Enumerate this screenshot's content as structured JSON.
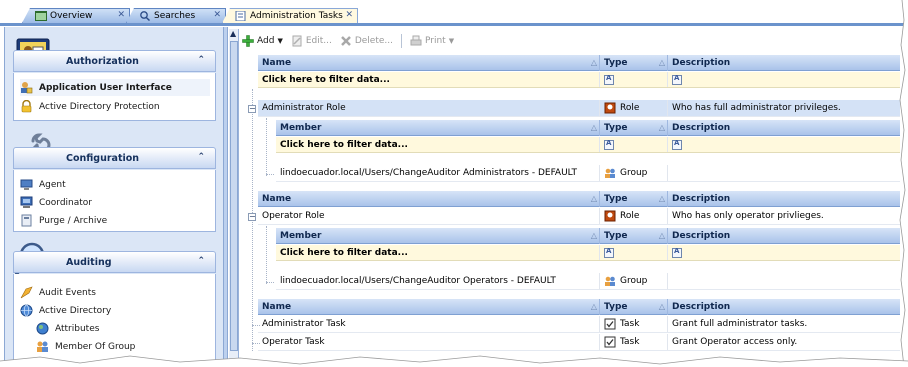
{
  "tabs": [
    {
      "label": "Overview",
      "active": false
    },
    {
      "label": "Searches",
      "active": false
    },
    {
      "label": "Administration Tasks",
      "active": true
    }
  ],
  "nav": {
    "groups": [
      {
        "title": "Authorization",
        "icon": "authorization-icon",
        "items": [
          {
            "label": "Application User Interface",
            "icon": "user-lock-icon",
            "selected": true
          },
          {
            "label": "Active Directory Protection",
            "icon": "padlock-icon",
            "selected": false
          }
        ]
      },
      {
        "title": "Configuration",
        "icon": "wrench-icon",
        "items": [
          {
            "label": "Agent",
            "icon": "agent-icon"
          },
          {
            "label": "Coordinator",
            "icon": "coordinator-icon"
          },
          {
            "label": "Purge / Archive",
            "icon": "purge-icon"
          }
        ]
      },
      {
        "title": "Auditing",
        "icon": "magnifier-icon",
        "items": [
          {
            "label": "Audit Events",
            "icon": "audit-events-icon"
          },
          {
            "label": "Active Directory",
            "icon": "globe-icon"
          },
          {
            "label": "Attributes",
            "icon": "globe-small-icon"
          },
          {
            "label": "Member Of Group",
            "icon": "group-icon"
          }
        ]
      }
    ]
  },
  "toolbar": {
    "add": "Add",
    "edit": "Edit...",
    "delete": "Delete...",
    "print": "Print"
  },
  "grid": {
    "headers": {
      "name": "Name",
      "type": "Type",
      "description": "Description",
      "member": "Member"
    },
    "filter_text": "Click here to filter data...",
    "roles": [
      {
        "name": "Administrator Role",
        "type": "Role",
        "description": "Who has full administrator privileges.",
        "members": [
          {
            "name": "lindoecuador.local/Users/ChangeAuditor Administrators - DEFAULT",
            "type": "Group"
          }
        ]
      },
      {
        "name": "Operator Role",
        "type": "Role",
        "description": "Who has only operator privlieges.",
        "members": [
          {
            "name": "lindoecuador.local/Users/ChangeAuditor Operators - DEFAULT",
            "type": "Group"
          }
        ]
      }
    ],
    "tasks": [
      {
        "name": "Administrator Task",
        "type": "Task",
        "description": "Grant full administrator tasks."
      },
      {
        "name": "Operator Task",
        "type": "Task",
        "description": "Grant Operator access only."
      }
    ]
  },
  "colors": {
    "accent": "#6b93cc",
    "header": "#a9c3ea",
    "filter_row": "#fff9dd",
    "selected_row": "#d4e2f6",
    "nav_bg": "#dbe6f6"
  }
}
